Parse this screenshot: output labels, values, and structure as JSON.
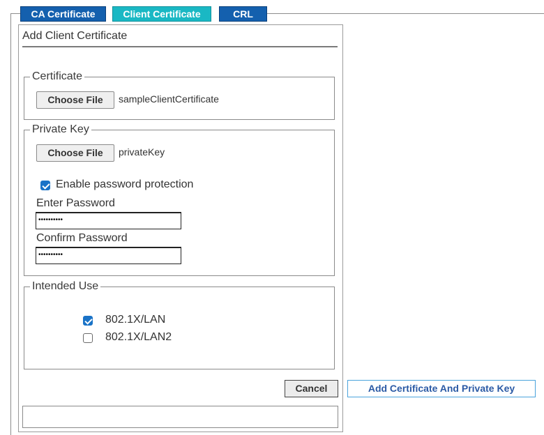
{
  "tabs": [
    {
      "label": "CA Certificate",
      "active": false
    },
    {
      "label": "Client Certificate",
      "active": true
    },
    {
      "label": "CRL",
      "active": false
    }
  ],
  "panel": {
    "title": "Add Client Certificate"
  },
  "certificate": {
    "legend": "Certificate",
    "choose_label": "Choose File",
    "file_name": "sampleClientCertificate"
  },
  "private_key": {
    "legend": "Private Key",
    "choose_label": "Choose File",
    "file_name": "privateKey",
    "enable_password_label": "Enable password protection",
    "enable_password_checked": true,
    "enter_password_label": "Enter Password",
    "enter_password_value": "••••••••••",
    "confirm_password_label": "Confirm Password",
    "confirm_password_value": "••••••••••"
  },
  "intended_use": {
    "legend": "Intended Use",
    "options": [
      {
        "label": "802.1X/LAN",
        "checked": true
      },
      {
        "label": "802.1X/LAN2",
        "checked": false
      }
    ]
  },
  "actions": {
    "cancel_label": "Cancel",
    "submit_label": "Add Certificate And Private Key"
  },
  "status": {
    "message": ""
  },
  "colors": {
    "tab_blue": "#1460ae",
    "tab_active": "#1ab8c4",
    "checkbox_checked": "#1a73c7",
    "submit_text": "#2b5aa5"
  }
}
